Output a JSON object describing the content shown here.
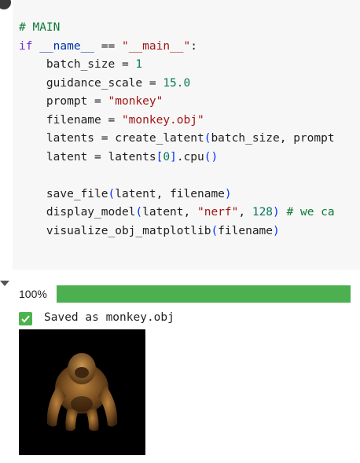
{
  "code_cell": {
    "lines": [
      [
        {
          "t": "# MAIN",
          "c": "comment"
        }
      ],
      [
        {
          "t": "if",
          "c": "keyword"
        },
        {
          "t": " ",
          "c": "plain"
        },
        {
          "t": "__name__",
          "c": "dunder"
        },
        {
          "t": " == ",
          "c": "plain"
        },
        {
          "t": "\"__main__\"",
          "c": "string"
        },
        {
          "t": ":",
          "c": "plain"
        }
      ],
      [
        {
          "t": "    batch_size = ",
          "c": "plain"
        },
        {
          "t": "1",
          "c": "number"
        }
      ],
      [
        {
          "t": "    guidance_scale = ",
          "c": "plain"
        },
        {
          "t": "15.0",
          "c": "number"
        }
      ],
      [
        {
          "t": "    prompt = ",
          "c": "plain"
        },
        {
          "t": "\"monkey\"",
          "c": "string"
        }
      ],
      [
        {
          "t": "    filename = ",
          "c": "plain"
        },
        {
          "t": "\"monkey.obj\"",
          "c": "string"
        }
      ],
      [
        {
          "t": "    latents = create_latent",
          "c": "plain"
        },
        {
          "t": "(",
          "c": "bracket-blue"
        },
        {
          "t": "batch_size, prompt",
          "c": "plain"
        }
      ],
      [
        {
          "t": "    latent = latents",
          "c": "plain"
        },
        {
          "t": "[",
          "c": "bracket-blue"
        },
        {
          "t": "0",
          "c": "number"
        },
        {
          "t": "]",
          "c": "bracket-blue"
        },
        {
          "t": ".cpu",
          "c": "plain"
        },
        {
          "t": "()",
          "c": "bracket-blue"
        }
      ],
      [
        {
          "t": "",
          "c": "plain"
        }
      ],
      [
        {
          "t": "    save_file",
          "c": "plain"
        },
        {
          "t": "(",
          "c": "bracket-blue"
        },
        {
          "t": "latent, filename",
          "c": "plain"
        },
        {
          "t": ")",
          "c": "bracket-blue"
        }
      ],
      [
        {
          "t": "    display_model",
          "c": "plain"
        },
        {
          "t": "(",
          "c": "bracket-blue"
        },
        {
          "t": "latent, ",
          "c": "plain"
        },
        {
          "t": "\"nerf\"",
          "c": "string"
        },
        {
          "t": ", ",
          "c": "plain"
        },
        {
          "t": "128",
          "c": "number"
        },
        {
          "t": ") ",
          "c": "bracket-blue"
        },
        {
          "t": "# we ca",
          "c": "comment"
        }
      ],
      [
        {
          "t": "    visualize_obj_matplotlib",
          "c": "plain"
        },
        {
          "t": "(",
          "c": "bracket-blue"
        },
        {
          "t": "filename",
          "c": "plain"
        },
        {
          "t": ")",
          "c": "bracket-blue"
        }
      ]
    ]
  },
  "output": {
    "progress_label": "100%",
    "progress_fraction": 1.0,
    "saved_text": "Saved as monkey.obj",
    "colors": {
      "progress_fill": "#4caf50",
      "check_bg": "#4cb44c"
    },
    "image_icon": "monkey-render-image"
  }
}
